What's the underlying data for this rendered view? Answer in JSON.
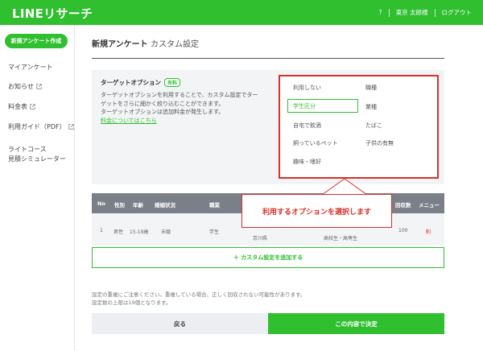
{
  "header": {
    "logo": "LINEリサーチ",
    "help": "?",
    "user": "東京 太郎様",
    "logout": "ログアウト",
    "bg_color": "#2fbf2f"
  },
  "sidebar": {
    "new_button": "新規アンケート作成",
    "items": [
      {
        "label": "マイアンケート"
      },
      {
        "label": "お知らせ",
        "icon": "external-link-icon"
      },
      {
        "label": "料金表",
        "icon": "external-link-icon"
      },
      {
        "label": "利用ガイド（PDF）",
        "icon": "external-link-icon"
      },
      {
        "label": "ライトコース"
      },
      {
        "label": "見積シミュレーター"
      }
    ]
  },
  "main": {
    "title": "新規アンケート",
    "subtitle": "カスタム設定",
    "target": {
      "heading": "ターゲットオプション",
      "badge": "有料",
      "desc1": "ターゲットオプションを利用することで、カスタム設定でター",
      "desc2": "ゲットをさらに細かく絞り込むことができます。",
      "desc3": "ターゲットオプションは追加料金が発生します。",
      "link": "料金についてはこちら"
    },
    "options": {
      "col1": [
        "利用しない",
        "学生区分",
        "自宅で飲酒",
        "飼っているペット",
        "趣味・嗜好"
      ],
      "col2": [
        "職種",
        "業種",
        "たばこ",
        "子供の有無"
      ],
      "selected": "学生区分"
    },
    "table": {
      "headers": [
        "No",
        "性別",
        "年齢",
        "婚姻状況",
        "職業",
        "回収数",
        "メニュー"
      ],
      "row": {
        "no": "1",
        "gender": "男性",
        "age": "15-19歳",
        "marital": "未婚",
        "job": "学生",
        "region": "京川県",
        "student": "高校生・高専生",
        "count": "100",
        "delete": "削"
      }
    },
    "callout": "利用するオプションを選択します",
    "add_row": "＋ カスタム設定を追加する",
    "notes": [
      "設定の重複にご注意ください。重複している場合、正しく回収されない可能性があります。",
      "設定数の上限は19個となります。"
    ],
    "back_button": "戻る",
    "confirm_button": "この内容で決定",
    "accent_color": "#d9302a"
  }
}
